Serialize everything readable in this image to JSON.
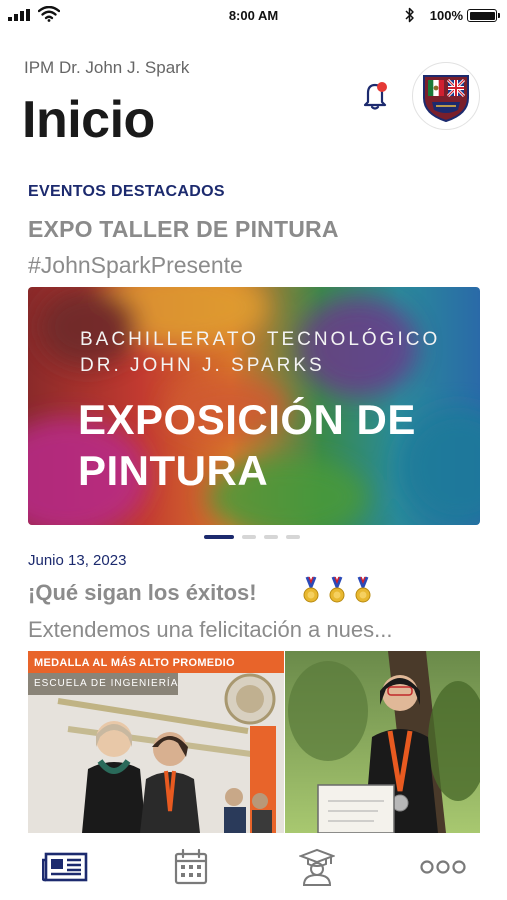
{
  "status_bar": {
    "time": "8:00 AM",
    "battery_percent": "100%",
    "battery_level": 1.0
  },
  "header": {
    "school_name": "IPM Dr. John J. Spark",
    "title": "Inicio",
    "notification_icon": "bell-icon",
    "has_notification": true,
    "crest_icon": "school-crest-icon"
  },
  "featured": {
    "section_label": "EVENTOS DESTACADOS",
    "event_title": "EXPO TALLER DE PINTURA",
    "event_hashtag": "#JohnSparkPresente",
    "banner": {
      "subtitle_line1": "BACHILLERATO TECNOLÓGICO",
      "subtitle_line2": "DR. JOHN J. SPARKS",
      "headline_line1": "EXPOSICIÓN DE",
      "headline_line2": "PINTURA"
    },
    "carousel": {
      "total_slides": 4,
      "active_index": 0
    }
  },
  "news": {
    "date": "Junio 13, 2023",
    "title": "¡Qué sigan los éxitos!",
    "medal_icons": [
      "medal-icon",
      "medal-icon",
      "medal-icon"
    ],
    "excerpt": "Extendemos una felicitación a nues...",
    "photo": {
      "banner_text": "MEDALLA AL MÁS ALTO PROMEDIO",
      "school_text": "ESCUELA DE INGENIERÍA"
    }
  },
  "bottom_nav": {
    "items": [
      {
        "icon": "news-icon",
        "active": true
      },
      {
        "icon": "calendar-icon",
        "active": false
      },
      {
        "icon": "graduate-icon",
        "active": false
      },
      {
        "icon": "more-icon",
        "active": false
      }
    ]
  },
  "colors": {
    "accent_navy": "#1c2a6e",
    "muted_text": "#8b8b8b",
    "notification_dot": "#e53935",
    "inactive_icon": "#7a7a7a"
  }
}
